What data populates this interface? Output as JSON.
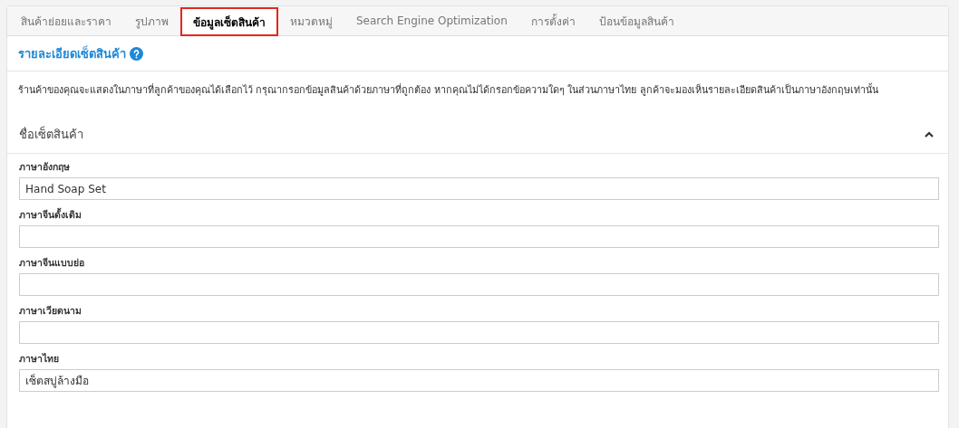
{
  "tabs": [
    {
      "label": "สินค้าย่อยและราคา",
      "selected": false
    },
    {
      "label": "รูปภาพ",
      "selected": false
    },
    {
      "label": "ข้อมูลเซ็ตสินค้า",
      "selected": true
    },
    {
      "label": "หมวดหมู่",
      "selected": false
    },
    {
      "label": "Search Engine Optimization",
      "selected": false
    },
    {
      "label": "การตั้งค่า",
      "selected": false
    },
    {
      "label": "ป้อนข้อมูลสินค้า",
      "selected": false
    }
  ],
  "section_title": "รายละเอียดเซ็ตสินค้า",
  "description": "ร้านค้าของคุณจะแสดงในภาษาที่ลูกค้าของคุณได้เลือกไว้ กรุณากรอกข้อมูลสินค้าด้วยภาษาที่ถูกต้อง หากคุณไม่ได้กรอกข้อความใดๆ ในส่วนภาษาไทย ลูกค้าจะมองเห็นรายละเอียดสินค้าเป็นภาษาอังกฤษเท่านั้น",
  "panel": {
    "title": "ชื่อเซ็ตสินค้า",
    "expanded": true,
    "fields": [
      {
        "label": "ภาษาอังกฤษ",
        "value": "Hand Soap Set"
      },
      {
        "label": "ภาษาจีนดั้งเดิม"
      },
      {
        "label": "ภาษาจีนแบบย่อ"
      },
      {
        "label": "ภาษาเวียดนาม"
      },
      {
        "label": "ภาษาไทย",
        "value": "เซ็ตสบู่ล้างมือ"
      }
    ]
  }
}
